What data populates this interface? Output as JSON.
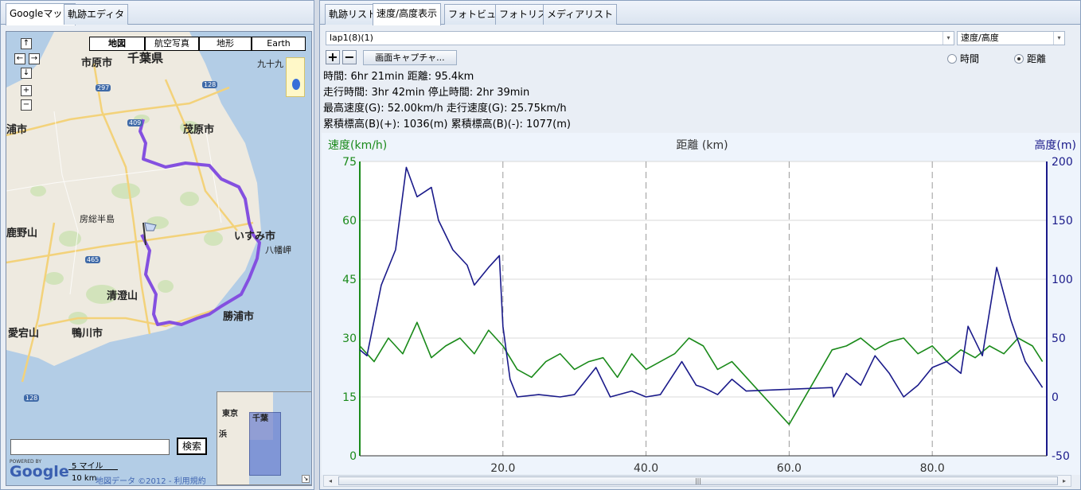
{
  "left_tabs": [
    "Googleマップ",
    "軌跡エディタ"
  ],
  "right_tabs": [
    "軌跡リスト",
    "速度/高度表示",
    "フォトビュー",
    "フォトリスト",
    "メディアリスト"
  ],
  "map": {
    "types": [
      "地図",
      "航空写真",
      "地形",
      "Earth"
    ],
    "labels": [
      "市原市",
      "千葉県",
      "茂原市",
      "いすみ市",
      "八幡岬",
      "房総半島",
      "鹿野山",
      "清澄山",
      "勝浦市",
      "愛宕山",
      "鴨川市",
      "浦市",
      "東京",
      "浜",
      "千葉",
      "九十九"
    ],
    "road_numbers": [
      "297",
      "128",
      "409",
      "465",
      "128"
    ],
    "search_placeholder": "",
    "search_button": "検索",
    "powered_by": "POWERED BY",
    "logo": "Google",
    "scale_miles": "5 マイル",
    "scale_km": "10 km",
    "map_data": "地図データ ©2012",
    "terms": "利用規約"
  },
  "controls": {
    "lap_select": "lap1(8)(1)",
    "mode_select": "速度/高度",
    "plus": "+",
    "minus": "−",
    "capture": "画面キャプチャ...",
    "radio_time": "時間",
    "radio_distance": "距離",
    "radio_selected": "distance"
  },
  "stats": [
    "時間: 6hr 21min  距離: 95.4km",
    "走行時間: 3hr 42min  停止時間: 2hr 39min",
    "最高速度(G): 52.00km/h  走行速度(G): 25.75km/h",
    "累積標高(B)(+): 1036(m)  累積標高(B)(-): 1077(m)"
  ],
  "chart_data": {
    "type": "line",
    "xlabel": "距離 (km)",
    "ylabel_left": "速度(km/h)",
    "ylabel_right": "高度(m)",
    "xlim": [
      0,
      96
    ],
    "ylim_left": [
      0,
      75
    ],
    "ylim_right": [
      -50,
      200
    ],
    "x_ticks": [
      "20.0",
      "40.0",
      "60.0",
      "80.0"
    ],
    "y_ticks_left": [
      "0",
      "15",
      "30",
      "45",
      "60",
      "75"
    ],
    "y_ticks_right": [
      "-50",
      "0",
      "50",
      "100",
      "150",
      "200"
    ],
    "grid": true,
    "series": [
      {
        "name": "速度(km/h)",
        "color": "#1a8a1a",
        "axis": "left",
        "x": [
          0,
          2,
          4,
          6,
          8,
          10,
          12,
          14,
          16,
          18,
          20,
          22,
          24,
          26,
          28,
          30,
          32,
          34,
          36,
          38,
          40,
          42,
          44,
          46,
          48,
          50,
          52,
          54,
          60,
          66,
          68,
          70,
          72,
          74,
          76,
          78,
          80,
          82,
          84,
          86,
          88,
          90,
          92,
          94,
          95.4
        ],
        "values": [
          28,
          24,
          30,
          26,
          34,
          25,
          28,
          30,
          26,
          32,
          28,
          22,
          20,
          24,
          26,
          22,
          24,
          25,
          20,
          26,
          22,
          24,
          26,
          30,
          28,
          22,
          24,
          20,
          8,
          27,
          28,
          30,
          27,
          29,
          30,
          26,
          28,
          24,
          27,
          25,
          28,
          26,
          30,
          28,
          24
        ]
      },
      {
        "name": "高度(m)",
        "color": "#1a1a8a",
        "axis": "right",
        "x": [
          0,
          1,
          3,
          5,
          6.5,
          8,
          10,
          11,
          13,
          15,
          16,
          18,
          19.5,
          20,
          21,
          22,
          25,
          28,
          30,
          33,
          35,
          38,
          40,
          42,
          45,
          47,
          48,
          50,
          52,
          54,
          66,
          66.2,
          68,
          70,
          72,
          74,
          76,
          78,
          80,
          82,
          84,
          85,
          87,
          89,
          91,
          93,
          95.4
        ],
        "values": [
          40,
          35,
          95,
          125,
          195,
          170,
          178,
          150,
          125,
          112,
          95,
          110,
          120,
          60,
          15,
          0,
          2,
          0,
          2,
          25,
          0,
          5,
          0,
          2,
          30,
          10,
          8,
          2,
          15,
          5,
          8,
          0,
          20,
          10,
          35,
          20,
          0,
          10,
          25,
          30,
          20,
          60,
          35,
          110,
          65,
          30,
          8
        ]
      }
    ]
  }
}
